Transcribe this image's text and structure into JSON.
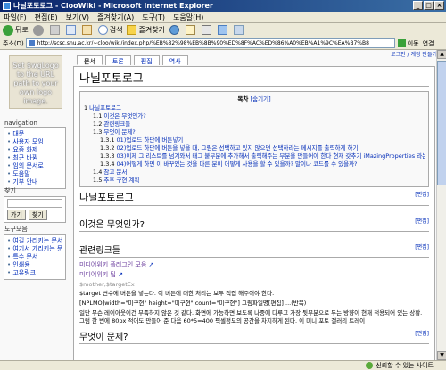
{
  "window": {
    "title": "나닐포토로그 - ClooWiki - Microsoft Internet Explorer"
  },
  "menu": [
    "파일(F)",
    "편집(E)",
    "보기(V)",
    "즐겨찾기(A)",
    "도구(T)",
    "도움말(H)"
  ],
  "toolbar": {
    "back_label": "뒤로",
    "search_label": "검색",
    "favorites_label": "즐겨찾기"
  },
  "address": {
    "label": "주소(D)",
    "url": "http://scsc.snu.ac.kr/~cloo/wiki/index.php/%EB%82%98%EB%8B%90%ED%8F%AC%ED%86%A0%EB%A1%9C%EA%B7%B8",
    "go_label": "이동",
    "links_label": "연결"
  },
  "top_right": {
    "login_text": "로그인 / 계정 만들기"
  },
  "tabs": [
    "문서",
    "토론",
    "편집",
    "역사"
  ],
  "logo_text": "Set $wgLogo to the URL path to your own logo image.",
  "navigation": {
    "title": "navigation",
    "items": [
      "대문",
      "사용자 모임",
      "요즘 화제",
      "최근 바뀜",
      "임의 문서로",
      "도움말",
      "기부 안내"
    ]
  },
  "search": {
    "title": "찾기",
    "go_button": "가기",
    "search_button": "찾기"
  },
  "tools": {
    "title": "도구모음",
    "items": [
      "여길 가리키는 문서",
      "여기서 가리키는 문서",
      "특수 문서",
      "인쇄용",
      "고유링크"
    ]
  },
  "page": {
    "title": "나닐포토로그",
    "toc": {
      "title": "목차",
      "hide_label": "[숨기기]",
      "items": [
        {
          "num": "1",
          "text": "나닐포토로그",
          "level": 1
        },
        {
          "num": "1.1",
          "text": "이것은 무엇인가?",
          "level": 2
        },
        {
          "num": "1.2",
          "text": "관련링크들",
          "level": 2
        },
        {
          "num": "1.3",
          "text": "무엇이 문제?",
          "level": 2
        },
        {
          "num": "1.3.1",
          "text": "01)업로드 하단에 버튼넣기",
          "level": 3
        },
        {
          "num": "1.3.2",
          "text": "02)업로드 하단에 버튼을 넣을 때, 그림은 선택하고 있지 않으면 선택하라는 메시지를 출력하게 하기",
          "level": 3
        },
        {
          "num": "1.3.3",
          "text": "03)이제 그 리스트를 넘겨와서 태그 붙부분에 추가해서 출력해주는 부분을 만들어야 한다 현재 갖추기 iMazingProperties 라는 것을 선언 했을때 동작하게 만든 코딩을 하고 이 버섯은",
          "level": 3
        },
        {
          "num": "1.3.4",
          "text": "04)어떻게 하면 이 바꾸었는 것을 다른 분이 어떻게 사용을 할 수 있을까? 말이나 코드를 수 있을까?",
          "level": 3
        },
        {
          "num": "1.4",
          "text": "참고 문서",
          "level": 2
        },
        {
          "num": "1.5",
          "text": "추후 구현 계획",
          "level": 2
        }
      ]
    },
    "edit_label": "[편집]",
    "heading_main": "나닐포토로그",
    "heading_what": "이것은 무엇인가?",
    "heading_links": "관련링크들",
    "links": [
      "미디어위키 플러그인 모음",
      "미디어위키 팁"
    ],
    "mother_link": "$mother,$targetEx",
    "para1": "$target 변수에 버튼을 넣는다. 이 버튼에 대한 처리는 보두 직접 해주어야 한다.",
    "para2": "[NPLMO]width=\"미구현\" height=\"미구현\" count=\"미구현\"] 그림파일명[편집] ...(반복)",
    "para3": "일단 무슨 레이아웃이건 부족하지 않은 것 같다. 화면에 가능하면 보도록 나중에 다루고 가장 뒷부분으로 두는 방향이 현재 적용되어 있는 상황. 그럼 한 번에 80px 적어도 만들어 준 다음 60*5=400 픽셀정도의 공간을 차지하게 된다. 이 미니 포토 갤러리 트레이",
    "heading_problem": "무엇이 문제?"
  },
  "status": {
    "zone_label": "신뢰할 수 있는 사이트"
  }
}
